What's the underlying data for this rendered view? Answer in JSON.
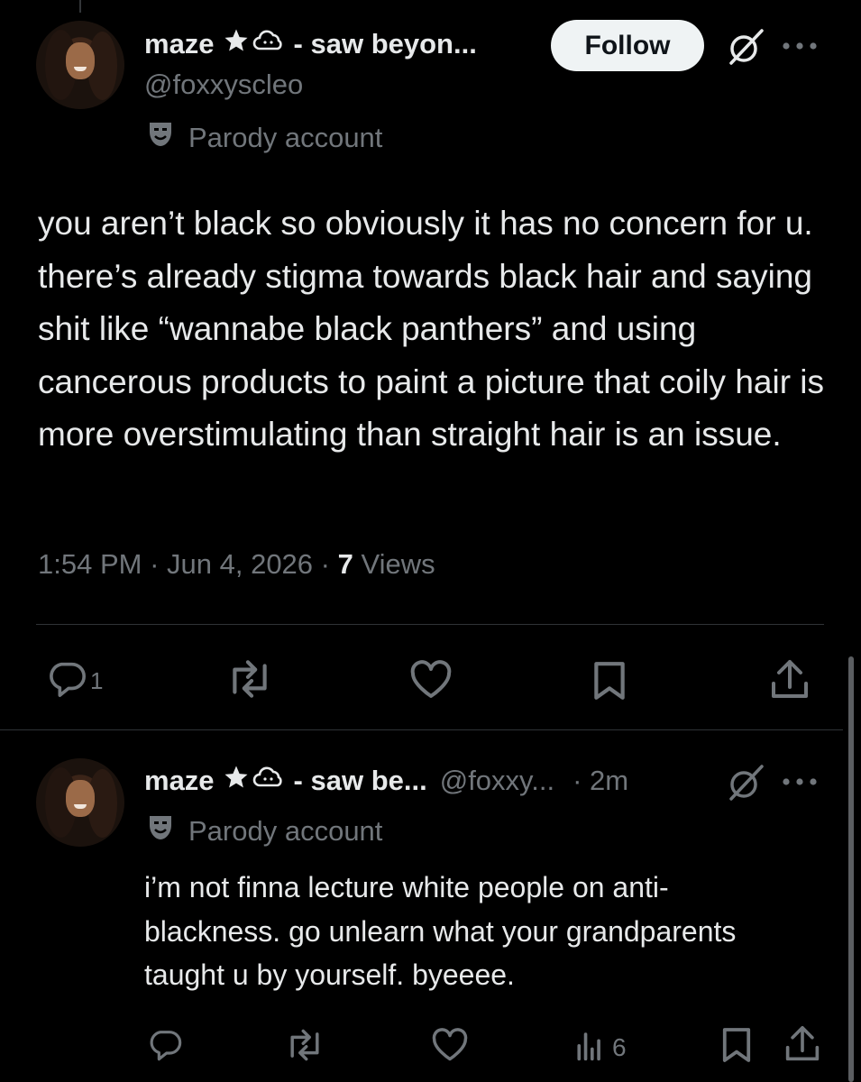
{
  "tweet": {
    "display_name": "maze ★😶‍🌫️ - saw beyon...",
    "name_text": "maze",
    "name_suffix": "- saw beyon...",
    "handle": "@foxxyscleo",
    "follow_label": "Follow",
    "parody_label": "Parody account",
    "body": "you aren’t black so obviously it has no concern for u. there’s already stigma towards black hair and saying shit like “wannabe black panthers” and using cancerous products to paint a picture that coily hair is more overstimulating than straight hair is an issue.",
    "time": "1:54 PM",
    "date": "Jun 4, 2026",
    "views_count": "7",
    "views_label": "Views",
    "reply_count": "1"
  },
  "reply": {
    "name_text": "maze",
    "name_suffix": "- saw be...",
    "handle": "@foxxy...",
    "age": "· 2m",
    "parody_label": "Parody account",
    "body": "i’m not finna lecture white people on anti-blackness. go unlearn what your grandparents taught u by yourself. byeeee.",
    "views_count": "6"
  },
  "colors": {
    "background": "#000000",
    "text": "#e7e9ea",
    "muted": "#71767b",
    "divider": "#2f3336",
    "follow_bg": "#eff3f4"
  }
}
